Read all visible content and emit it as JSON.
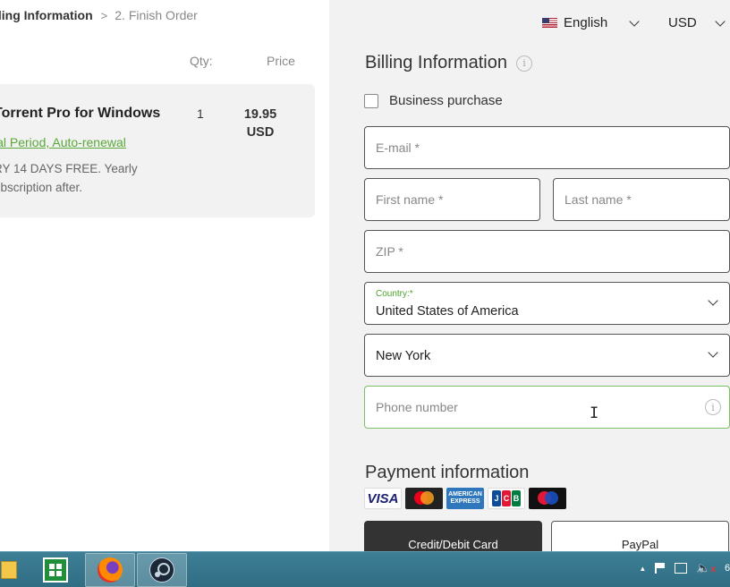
{
  "breadcrumb": {
    "current": "lling Information",
    "separator": ">",
    "next": "2. Finish Order"
  },
  "order": {
    "qty_header": "Qty:",
    "price_header": "Price",
    "product_name": "Torrent Pro for Windows",
    "product_link": "ial Period, Auto-renewal",
    "product_desc_1": "RY 14 DAYS FREE. Yearly",
    "product_desc_2": "ubscription after.",
    "qty": "1",
    "price_amount": "19.95",
    "price_currency": "USD"
  },
  "header": {
    "language": "English",
    "currency": "USD"
  },
  "billing": {
    "title": "Billing Information",
    "business_purchase": "Business purchase",
    "email_placeholder": "E-mail *",
    "first_name_placeholder": "First name *",
    "last_name_placeholder": "Last name *",
    "zip_placeholder": "ZIP *",
    "country_label": "Country:*",
    "country_value": "United States of America",
    "state_value": "New York",
    "phone_placeholder": "Phone number"
  },
  "payment": {
    "title": "Payment information",
    "card_logos": [
      "VISA",
      "Mastercard",
      "AMERICAN EXPRESS",
      "JCB",
      "Maestro"
    ],
    "card_button": "Credit/Debit Card",
    "paypal_button": "PayPal"
  },
  "taskbar": {
    "clock_fragment": "6"
  },
  "colors": {
    "accent_green": "#4ca32f",
    "panel_bg": "#f2f2f2",
    "taskbar": "#2f6d83"
  }
}
